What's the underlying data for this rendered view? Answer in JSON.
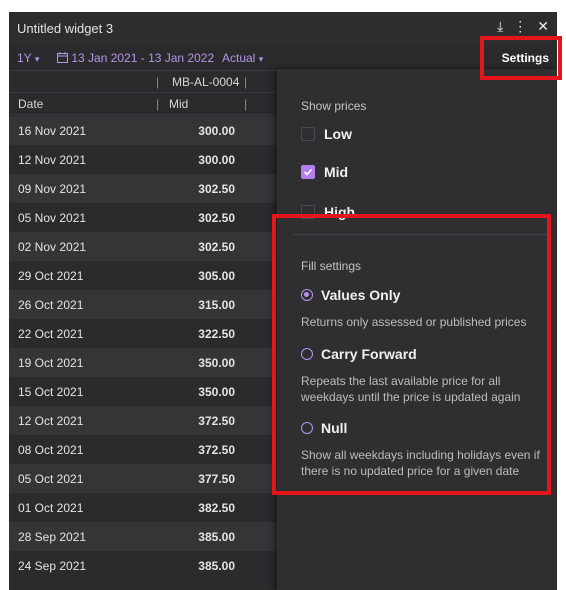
{
  "window": {
    "title": "Untitled widget 3"
  },
  "toolbar": {
    "period": "1Y",
    "date_range": "13 Jan 2021 - 13 Jan 2022",
    "mode": "Actual",
    "settings_label": "Settings"
  },
  "table": {
    "instrument": "MB-AL-0004",
    "date_header": "Date",
    "value_header": "Mid",
    "rows": [
      {
        "date": "16 Nov 2021",
        "value": "300.00"
      },
      {
        "date": "12 Nov 2021",
        "value": "300.00"
      },
      {
        "date": "09 Nov 2021",
        "value": "302.50"
      },
      {
        "date": "05 Nov 2021",
        "value": "302.50"
      },
      {
        "date": "02 Nov 2021",
        "value": "302.50"
      },
      {
        "date": "29 Oct 2021",
        "value": "305.00"
      },
      {
        "date": "26 Oct 2021",
        "value": "315.00"
      },
      {
        "date": "22 Oct 2021",
        "value": "322.50"
      },
      {
        "date": "19 Oct 2021",
        "value": "350.00"
      },
      {
        "date": "15 Oct 2021",
        "value": "350.00"
      },
      {
        "date": "12 Oct 2021",
        "value": "372.50"
      },
      {
        "date": "08 Oct 2021",
        "value": "372.50"
      },
      {
        "date": "05 Oct 2021",
        "value": "377.50"
      },
      {
        "date": "01 Oct 2021",
        "value": "382.50"
      },
      {
        "date": "28 Sep 2021",
        "value": "385.00"
      },
      {
        "date": "24 Sep 2021",
        "value": "385.00"
      }
    ]
  },
  "settings_panel": {
    "show_prices_heading": "Show prices",
    "prices": [
      {
        "label": "Low",
        "checked": false
      },
      {
        "label": "Mid",
        "checked": true
      },
      {
        "label": "High",
        "checked": false
      }
    ],
    "fill_heading": "Fill settings",
    "fill_options": [
      {
        "label": "Values Only",
        "selected": true,
        "description": "Returns only assessed or published prices"
      },
      {
        "label": "Carry Forward",
        "selected": false,
        "description": "Repeats the last available price for all weekdays until the price is updated again"
      },
      {
        "label": "Null",
        "selected": false,
        "description": "Show all weekdays including holidays even if there is no updated price for a given date"
      }
    ]
  },
  "colors": {
    "accent": "#b694e6",
    "highlight": "#e5151b",
    "background": "#2b2b2e"
  }
}
